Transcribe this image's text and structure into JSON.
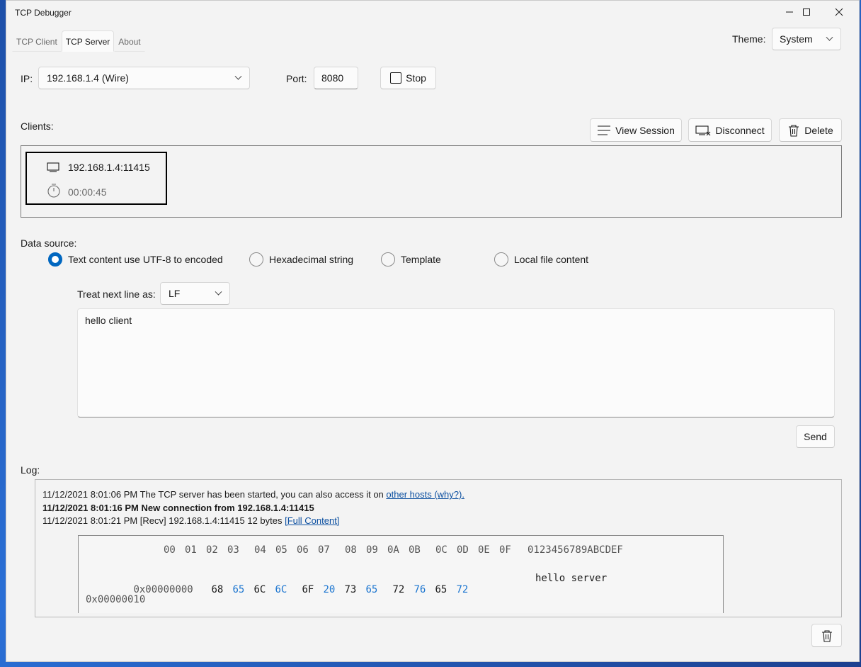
{
  "window": {
    "title": "TCP Debugger"
  },
  "tabs": [
    {
      "label": "TCP Client"
    },
    {
      "label": "TCP Server"
    },
    {
      "label": "About"
    }
  ],
  "theme": {
    "label": "Theme:",
    "value": "System"
  },
  "server": {
    "ip_label": "IP:",
    "ip_value": "192.168.1.4 (Wire)",
    "port_label": "Port:",
    "port_value": "8080",
    "stop_label": "Stop"
  },
  "clients": {
    "label": "Clients:",
    "view_session": "View Session",
    "disconnect": "Disconnect",
    "delete": "Delete",
    "items": [
      {
        "address": "192.168.1.4:11415",
        "duration": "00:00:45"
      }
    ]
  },
  "data_source": {
    "label": "Data source:",
    "options": [
      {
        "label": "Text content use UTF-8 to encoded",
        "selected": true
      },
      {
        "label": "Hexadecimal string",
        "selected": false
      },
      {
        "label": "Template",
        "selected": false
      },
      {
        "label": "Local file content",
        "selected": false
      }
    ],
    "newline_label": "Treat next line as:",
    "newline_value": "LF",
    "content": "hello client",
    "send_label": "Send"
  },
  "log": {
    "label": "Log:",
    "entries": [
      {
        "text": "11/12/2021 8:01:06 PM  The TCP server has been started, you can also access it on ",
        "link": "other hosts (why?)."
      },
      {
        "text": "11/12/2021 8:01:16 PM  New connection from 192.168.1.4:11415",
        "bold": true
      },
      {
        "text": "11/12/2021 8:01:21 PM  [Recv] 192.168.1.4:11415  12 bytes  ",
        "link": "[Full Content]"
      }
    ],
    "hex": {
      "header_bytes": [
        "00",
        "01",
        "02",
        "03",
        "04",
        "05",
        "06",
        "07",
        "08",
        "09",
        "0A",
        "0B",
        "0C",
        "0D",
        "0E",
        "0F"
      ],
      "header_ascii": "0123456789ABCDEF",
      "rows": [
        {
          "offset": "0x00000000",
          "bytes": [
            "68",
            "65",
            "6C",
            "6C",
            "6F",
            "20",
            "73",
            "65",
            "72",
            "76",
            "65",
            "72"
          ],
          "ascii": "hello server"
        },
        {
          "offset": "0x00000010",
          "bytes": [],
          "ascii": ""
        }
      ]
    }
  },
  "colors": {
    "accent": "#0067c0",
    "hex_alt": "#1b75d0",
    "link": "#0b4fa0"
  }
}
